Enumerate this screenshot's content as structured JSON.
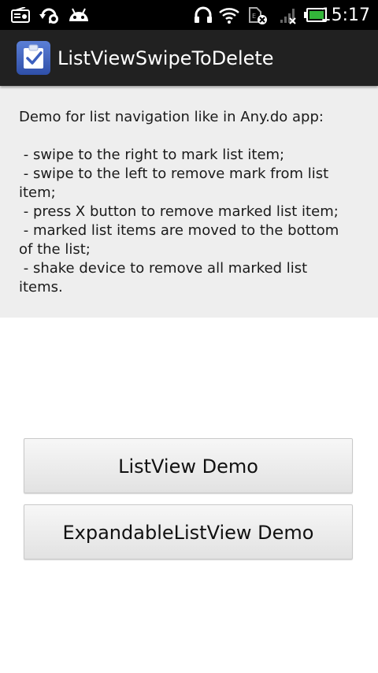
{
  "status_bar": {
    "time": "15:17",
    "icons_left": [
      "radio-icon",
      "sync-icon",
      "android-icon"
    ],
    "icons_right": [
      "headphones-icon",
      "wifi-icon",
      "sim-missing-icon",
      "signal-none-icon",
      "battery-charging-icon"
    ],
    "battery_color": "#33b53a"
  },
  "action_bar": {
    "title": "ListViewSwipeToDelete",
    "icon": "app-checklist-icon"
  },
  "description": {
    "lines": [
      "Demo for list navigation like in Any.do app:",
      "",
      " - swipe to the right to mark list item;",
      " - swipe to the left to remove mark from list",
      "item;",
      " - press X button to remove marked list item;",
      " - marked list items are moved to the bottom",
      "of the list;",
      " - shake device to remove all marked list",
      "items."
    ]
  },
  "buttons": {
    "listview_demo": "ListView Demo",
    "expandable_demo": "ExpandableListView Demo"
  }
}
